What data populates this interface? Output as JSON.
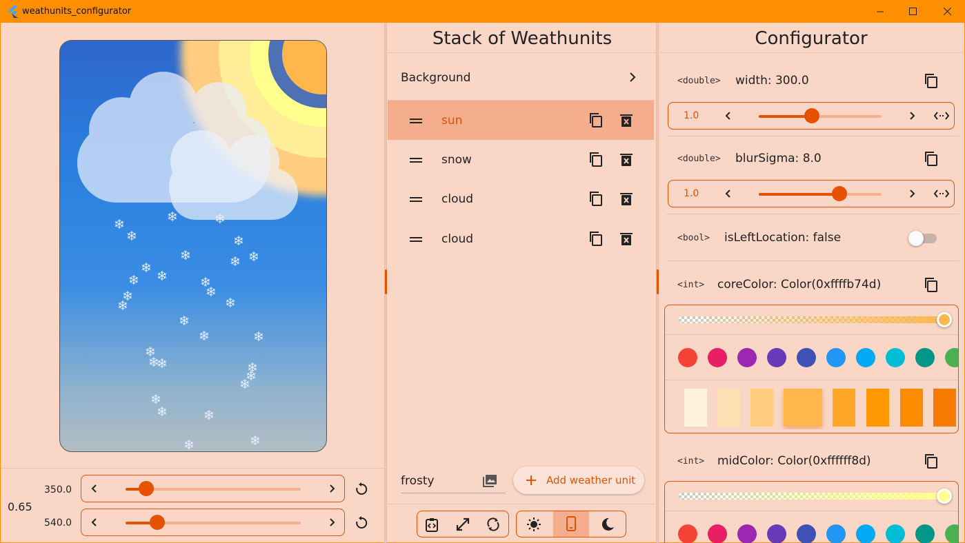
{
  "window": {
    "title": "weathunits_configurator"
  },
  "left": {
    "scale_value": "0.65",
    "width_value": "350.0",
    "height_value": "540.0",
    "width_fraction": 0.12,
    "height_fraction": 0.18
  },
  "stack": {
    "header": "Stack of Weathunits",
    "background_label": "Background",
    "units": [
      {
        "name": "sun",
        "selected": true
      },
      {
        "name": "snow",
        "selected": false
      },
      {
        "name": "cloud",
        "selected": false
      },
      {
        "name": "cloud",
        "selected": false
      }
    ],
    "preset_value": "frosty",
    "add_button_label": "Add weather unit"
  },
  "configurator": {
    "header": "Configurator",
    "width_param": {
      "type": "<double>",
      "label": "width: 300.0",
      "step": "1.0",
      "fraction": 0.43
    },
    "blur_param": {
      "type": "<double>",
      "label": "blurSigma: 8.0",
      "step": "1.0",
      "fraction": 0.66
    },
    "left_location_param": {
      "type": "<bool>",
      "label": "isLeftLocation: false",
      "value": false
    },
    "core_color_param": {
      "type": "<int>",
      "label": "coreColor: Color(0xffffb74d)",
      "color": "#ffb74d"
    },
    "mid_color_param": {
      "type": "<int>",
      "label": "midColor: Color(0xffffff8d)",
      "color": "#ffff8d"
    },
    "palette": [
      "#f44336",
      "#e91e63",
      "#9c27b0",
      "#673ab7",
      "#3f51b5",
      "#2196f3",
      "#03a9f4",
      "#00bcd4",
      "#009688",
      "#4caf50"
    ],
    "shades": [
      "#fff3e0",
      "#ffe0b2",
      "#ffcc80",
      "#ffb74d",
      "#ffa726",
      "#ff9800",
      "#fb8c00",
      "#f57c00"
    ]
  },
  "colors": {
    "accent": "#e65100",
    "titlebar": "#ff8f00",
    "panel": "#f9d6c6",
    "selected_row": "#f4ae8e"
  }
}
